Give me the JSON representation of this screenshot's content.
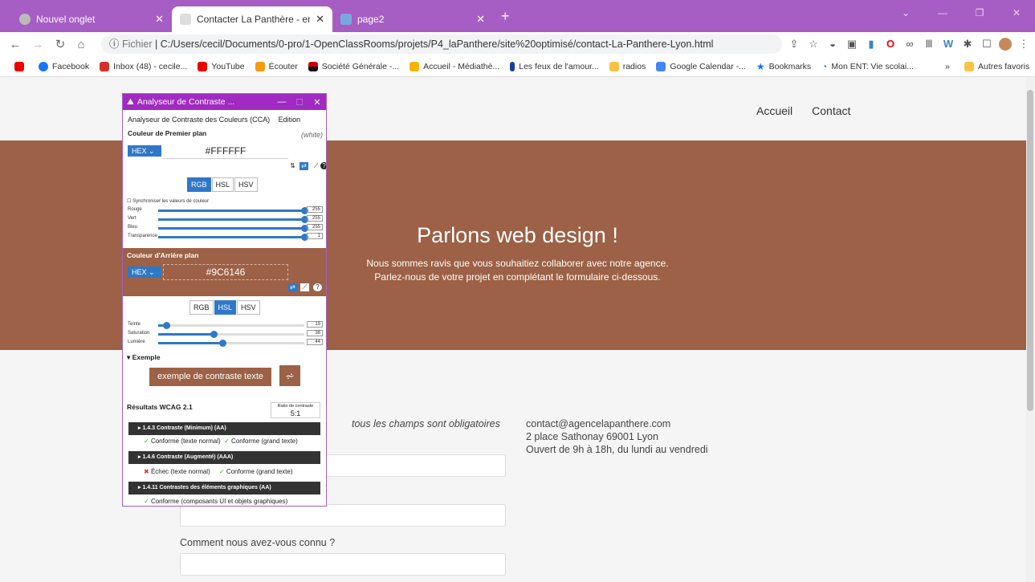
{
  "browser": {
    "tabs": [
      {
        "title": "Nouvel onglet",
        "active": false
      },
      {
        "title": "Contacter La Panthère - entrepri",
        "active": true
      },
      {
        "title": "page2",
        "active": false
      }
    ],
    "new_tab_label": "+",
    "url_prefix": "Fichier",
    "url": "C:/Users/cecil/Documents/0-pro/1-OpenClassRooms/projets/P4_laPanthere/site%20optimisé/contact-La-Panthere-Lyon.html",
    "bookmarks": [
      {
        "label": "",
        "color": "#e00"
      },
      {
        "label": "Facebook",
        "color": "#1877f2"
      },
      {
        "label": "Inbox (48) - cecile...",
        "color": "#d93025"
      },
      {
        "label": "YouTube",
        "color": "#e00"
      },
      {
        "label": "Écouter",
        "color": "#f39c12"
      },
      {
        "label": "Société Générale -...",
        "color": "#c00"
      },
      {
        "label": "Accueil - Médiathè...",
        "color": "#f5b400"
      },
      {
        "label": "Les feux de l'amour...",
        "color": "#1a3e9a"
      },
      {
        "label": "radios",
        "color": "#f6c343"
      },
      {
        "label": "Google Calendar -...",
        "color": "#4285f4"
      },
      {
        "label": "Bookmarks",
        "color": "#1a73e8"
      },
      {
        "label": "Mon ENT: Vie scolai...",
        "color": "#3b82c4"
      }
    ],
    "bookmarks_overflow": "»",
    "other_bookmarks": "Autres favoris"
  },
  "site": {
    "nav": [
      "Accueil",
      "Contact"
    ],
    "hero_title": "Parlons web design !",
    "hero_line1": "Nous sommes ravis que vous souhaitiez collaborer avec notre agence.",
    "hero_line2": "Parlez-nous de votre projet en complétant le formulaire ci-dessous.",
    "required_note": "tous les champs sont obligatoires",
    "contact_email": "contact@agencelapanthere.com",
    "contact_address": "2 place Sathonay 69001 Lyon",
    "contact_hours": "Ouvert de 9h à 18h, du lundi au vendredi",
    "how_label": "Comment nous avez-vous connu ?",
    "hero_color": "#9C6146"
  },
  "cca": {
    "window_title": "Analyseur de Contraste ...",
    "menu": [
      "Analyseur de Contraste des Couleurs (CCA)",
      "Edition"
    ],
    "fg": {
      "heading": "Couleur de Premier plan",
      "name": "(white)",
      "format": "HEX",
      "value": "#FFFFFF",
      "modes": [
        "RGB",
        "HSL",
        "HSV"
      ],
      "active_mode": "RGB",
      "sync_label": "Synchroniser les valeurs de couleur",
      "sliders": [
        {
          "label": "Rouge",
          "value": 255,
          "max": 255
        },
        {
          "label": "Vert",
          "value": 255,
          "max": 255
        },
        {
          "label": "Bleu",
          "value": 255,
          "max": 255
        },
        {
          "label": "Transparence",
          "value": 1,
          "max": 1
        }
      ]
    },
    "bg": {
      "heading": "Couleur d'Arrière plan",
      "format": "HEX",
      "value": "#9C6146",
      "modes": [
        "RGB",
        "HSL",
        "HSV"
      ],
      "active_mode": "HSL",
      "sliders": [
        {
          "label": "Teinte",
          "value": 19,
          "max": 360
        },
        {
          "label": "Saturation",
          "value": 38,
          "max": 100
        },
        {
          "label": "Lumière",
          "value": 44,
          "max": 100
        }
      ]
    },
    "example_heading": "▾ Exemple",
    "example_text": "exemple de contraste texte",
    "results_heading": "Résultats WCAG 2.1",
    "ratio_label": "Ratio de contraste",
    "ratio_value": "5:1",
    "criteria": [
      {
        "title": "▸ 1.4.3 Contraste (Minimum) (AA)",
        "results": [
          {
            "text": "Conforme (texte normal)",
            "pass": true
          },
          {
            "text": "Conforme (grand texte)",
            "pass": true
          }
        ]
      },
      {
        "title": "▸ 1.4.6 Contraste (Augmenté) (AAA)",
        "results": [
          {
            "text": "Échec (texte normal)",
            "pass": false
          },
          {
            "text": "Conforme (grand texte)",
            "pass": true
          }
        ]
      },
      {
        "title": "▸ 1.4.11 Contrastes des éléments graphiques (AA)",
        "results": [
          {
            "text": "Conforme (composants UI et objets graphiques)",
            "pass": true
          }
        ]
      }
    ]
  }
}
